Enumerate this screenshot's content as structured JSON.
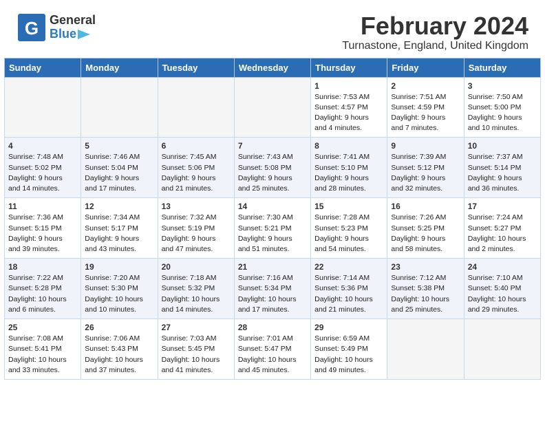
{
  "header": {
    "title": "February 2024",
    "subtitle": "Turnastone, England, United Kingdom",
    "logo_general": "General",
    "logo_blue": "Blue"
  },
  "weekdays": [
    "Sunday",
    "Monday",
    "Tuesday",
    "Wednesday",
    "Thursday",
    "Friday",
    "Saturday"
  ],
  "weeks": [
    [
      {
        "day": "",
        "info": ""
      },
      {
        "day": "",
        "info": ""
      },
      {
        "day": "",
        "info": ""
      },
      {
        "day": "",
        "info": ""
      },
      {
        "day": "1",
        "info": "Sunrise: 7:53 AM\nSunset: 4:57 PM\nDaylight: 9 hours\nand 4 minutes."
      },
      {
        "day": "2",
        "info": "Sunrise: 7:51 AM\nSunset: 4:59 PM\nDaylight: 9 hours\nand 7 minutes."
      },
      {
        "day": "3",
        "info": "Sunrise: 7:50 AM\nSunset: 5:00 PM\nDaylight: 9 hours\nand 10 minutes."
      }
    ],
    [
      {
        "day": "4",
        "info": "Sunrise: 7:48 AM\nSunset: 5:02 PM\nDaylight: 9 hours\nand 14 minutes."
      },
      {
        "day": "5",
        "info": "Sunrise: 7:46 AM\nSunset: 5:04 PM\nDaylight: 9 hours\nand 17 minutes."
      },
      {
        "day": "6",
        "info": "Sunrise: 7:45 AM\nSunset: 5:06 PM\nDaylight: 9 hours\nand 21 minutes."
      },
      {
        "day": "7",
        "info": "Sunrise: 7:43 AM\nSunset: 5:08 PM\nDaylight: 9 hours\nand 25 minutes."
      },
      {
        "day": "8",
        "info": "Sunrise: 7:41 AM\nSunset: 5:10 PM\nDaylight: 9 hours\nand 28 minutes."
      },
      {
        "day": "9",
        "info": "Sunrise: 7:39 AM\nSunset: 5:12 PM\nDaylight: 9 hours\nand 32 minutes."
      },
      {
        "day": "10",
        "info": "Sunrise: 7:37 AM\nSunset: 5:14 PM\nDaylight: 9 hours\nand 36 minutes."
      }
    ],
    [
      {
        "day": "11",
        "info": "Sunrise: 7:36 AM\nSunset: 5:15 PM\nDaylight: 9 hours\nand 39 minutes."
      },
      {
        "day": "12",
        "info": "Sunrise: 7:34 AM\nSunset: 5:17 PM\nDaylight: 9 hours\nand 43 minutes."
      },
      {
        "day": "13",
        "info": "Sunrise: 7:32 AM\nSunset: 5:19 PM\nDaylight: 9 hours\nand 47 minutes."
      },
      {
        "day": "14",
        "info": "Sunrise: 7:30 AM\nSunset: 5:21 PM\nDaylight: 9 hours\nand 51 minutes."
      },
      {
        "day": "15",
        "info": "Sunrise: 7:28 AM\nSunset: 5:23 PM\nDaylight: 9 hours\nand 54 minutes."
      },
      {
        "day": "16",
        "info": "Sunrise: 7:26 AM\nSunset: 5:25 PM\nDaylight: 9 hours\nand 58 minutes."
      },
      {
        "day": "17",
        "info": "Sunrise: 7:24 AM\nSunset: 5:27 PM\nDaylight: 10 hours\nand 2 minutes."
      }
    ],
    [
      {
        "day": "18",
        "info": "Sunrise: 7:22 AM\nSunset: 5:28 PM\nDaylight: 10 hours\nand 6 minutes."
      },
      {
        "day": "19",
        "info": "Sunrise: 7:20 AM\nSunset: 5:30 PM\nDaylight: 10 hours\nand 10 minutes."
      },
      {
        "day": "20",
        "info": "Sunrise: 7:18 AM\nSunset: 5:32 PM\nDaylight: 10 hours\nand 14 minutes."
      },
      {
        "day": "21",
        "info": "Sunrise: 7:16 AM\nSunset: 5:34 PM\nDaylight: 10 hours\nand 17 minutes."
      },
      {
        "day": "22",
        "info": "Sunrise: 7:14 AM\nSunset: 5:36 PM\nDaylight: 10 hours\nand 21 minutes."
      },
      {
        "day": "23",
        "info": "Sunrise: 7:12 AM\nSunset: 5:38 PM\nDaylight: 10 hours\nand 25 minutes."
      },
      {
        "day": "24",
        "info": "Sunrise: 7:10 AM\nSunset: 5:40 PM\nDaylight: 10 hours\nand 29 minutes."
      }
    ],
    [
      {
        "day": "25",
        "info": "Sunrise: 7:08 AM\nSunset: 5:41 PM\nDaylight: 10 hours\nand 33 minutes."
      },
      {
        "day": "26",
        "info": "Sunrise: 7:06 AM\nSunset: 5:43 PM\nDaylight: 10 hours\nand 37 minutes."
      },
      {
        "day": "27",
        "info": "Sunrise: 7:03 AM\nSunset: 5:45 PM\nDaylight: 10 hours\nand 41 minutes."
      },
      {
        "day": "28",
        "info": "Sunrise: 7:01 AM\nSunset: 5:47 PM\nDaylight: 10 hours\nand 45 minutes."
      },
      {
        "day": "29",
        "info": "Sunrise: 6:59 AM\nSunset: 5:49 PM\nDaylight: 10 hours\nand 49 minutes."
      },
      {
        "day": "",
        "info": ""
      },
      {
        "day": "",
        "info": ""
      }
    ]
  ]
}
